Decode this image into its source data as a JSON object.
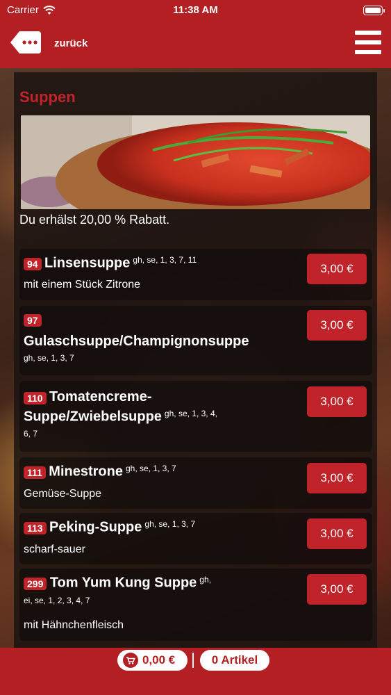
{
  "status": {
    "carrier": "Carrier",
    "time": "11:38 AM"
  },
  "header": {
    "back_label": "zurück"
  },
  "section": {
    "title": "Suppen",
    "discount": "Du erhälst 20,00 % Rabatt."
  },
  "items": [
    {
      "num": "94",
      "name": "Linsensuppe",
      "allergens": "gh, se, 1, 3, 7, 11",
      "desc": "mit einem Stück Zitrone",
      "price": "3,00 €"
    },
    {
      "num": "97",
      "name": "Gulaschsuppe/Champignonsuppe",
      "allergens": "gh, se, 1, 3, 7",
      "desc": "",
      "price": "3,00 €"
    },
    {
      "num": "110",
      "name_line1": "Tomatencreme-",
      "name_line2": "Suppe/Zwiebelsuppe",
      "allergens_line1": "gh, se, 1, 3, 4,",
      "allergens_line2": "6, 7",
      "desc": "",
      "price": "3,00 €"
    },
    {
      "num": "111",
      "name": "Minestrone",
      "allergens": "gh, se, 1, 3, 7",
      "desc": "Gemüse-Suppe",
      "price": "3,00 €"
    },
    {
      "num": "113",
      "name": "Peking-Suppe",
      "allergens": "gh, se, 1, 3, 7",
      "desc": "scharf-sauer",
      "price": "3,00 €"
    },
    {
      "num": "299",
      "name": "Tom Yum Kung Suppe",
      "allergens_line1": "gh,",
      "allergens_line2": "ei, se, 1, 2, 3, 4, 7",
      "desc": "mit Hähnchenfleisch",
      "price": "3,00 €"
    }
  ],
  "cart": {
    "total": "0,00 €",
    "count": "0 Artikel"
  },
  "colors": {
    "brand": "#b31f22",
    "accent": "#c0242a"
  }
}
